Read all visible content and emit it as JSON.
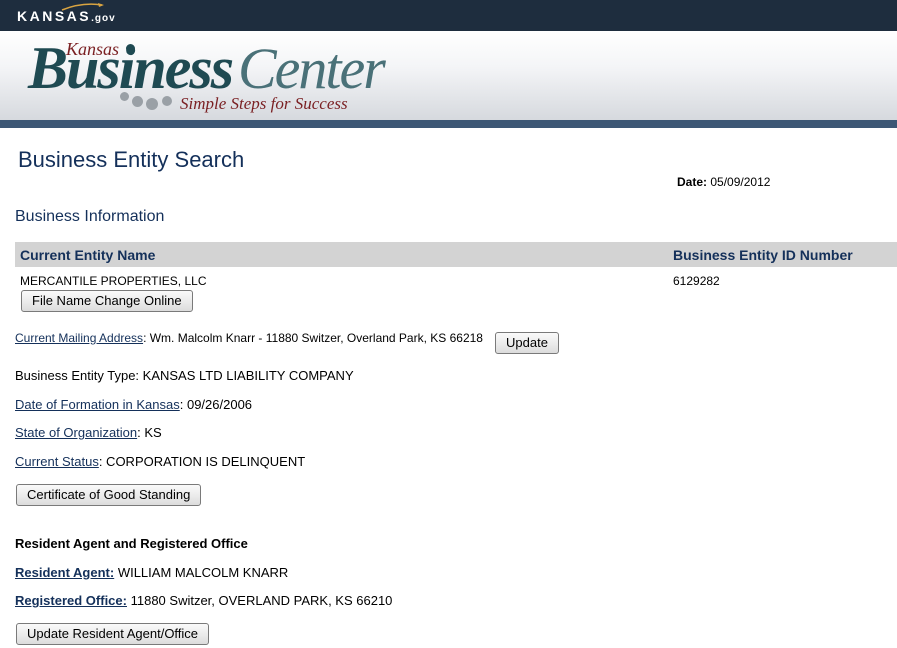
{
  "site": {
    "kansas_logo": "KANSAS",
    "kansas_logo_suffix": ".gov",
    "banner_kansas": "Kansas",
    "banner_business": "Business",
    "banner_center": "Center",
    "banner_tagline": "Simple Steps for Success"
  },
  "page": {
    "title": "Business Entity Search",
    "date_label": "Date:",
    "date_value": "05/09/2012",
    "section_title": "Business Information"
  },
  "table": {
    "col_name": "Current Entity Name",
    "col_id": "Business Entity ID Number",
    "entity_name": "MERCANTILE PROPERTIES, LLC",
    "entity_id": "6129282",
    "name_change_button": "File Name Change Online"
  },
  "fields": {
    "mailing_label": "Current Mailing Address",
    "mailing_value": ": Wm. Malcolm Knarr - 11880 Switzer, Overland Park, KS 66218",
    "update_button": "Update",
    "type_label": "Business Entity Type:",
    "type_value": " KANSAS LTD LIABILITY COMPANY",
    "formation_label": "Date of Formation in Kansas",
    "formation_value": ": 09/26/2006",
    "state_label": "State of Organization",
    "state_value": ": KS",
    "status_label": "Current Status",
    "status_value": ": CORPORATION IS DELINQUENT",
    "good_standing_button": "Certificate of Good Standing"
  },
  "agent": {
    "heading": "Resident Agent and Registered Office",
    "agent_label": "Resident Agent:",
    "agent_value": " WILLIAM MALCOLM KNARR",
    "office_label": "Registered Office:",
    "office_value": " 11880 Switzer, OVERLAND PARK, KS 66210",
    "update_button": "Update Resident Agent/Office"
  },
  "colors": {
    "topbar": "#1e2d3e",
    "rule": "#3d5775",
    "heading": "#14305a",
    "header_bg": "#d3d3d3"
  }
}
